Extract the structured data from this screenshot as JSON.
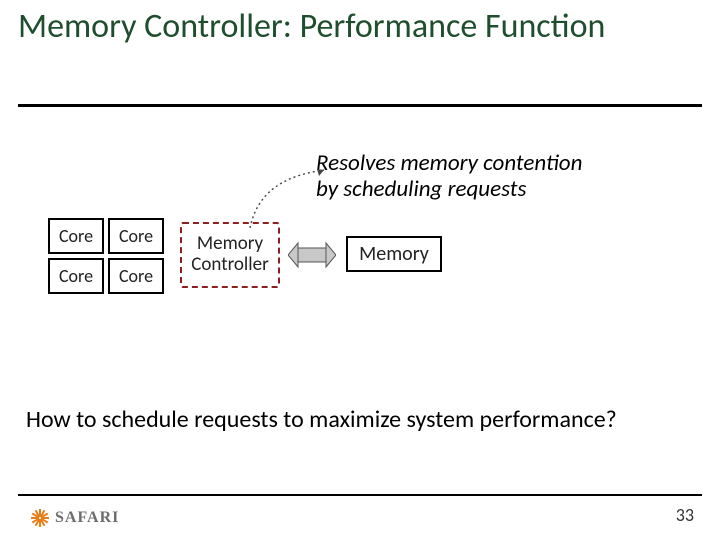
{
  "title": "Memory Controller: Performance Function",
  "caption_line1": "Resolves memory contention",
  "caption_line2": "by scheduling requests",
  "diagram": {
    "core_label": "Core",
    "memctl_label": "Memory Controller",
    "memory_label": "Memory"
  },
  "question": "How to schedule requests to maximize system performance?",
  "footer": {
    "brand": "SAFARI",
    "page_number": "33"
  },
  "colors": {
    "title": "#1f4e2e",
    "memctl_border": "#8a2020",
    "logo_accent": "#e57f1c"
  }
}
